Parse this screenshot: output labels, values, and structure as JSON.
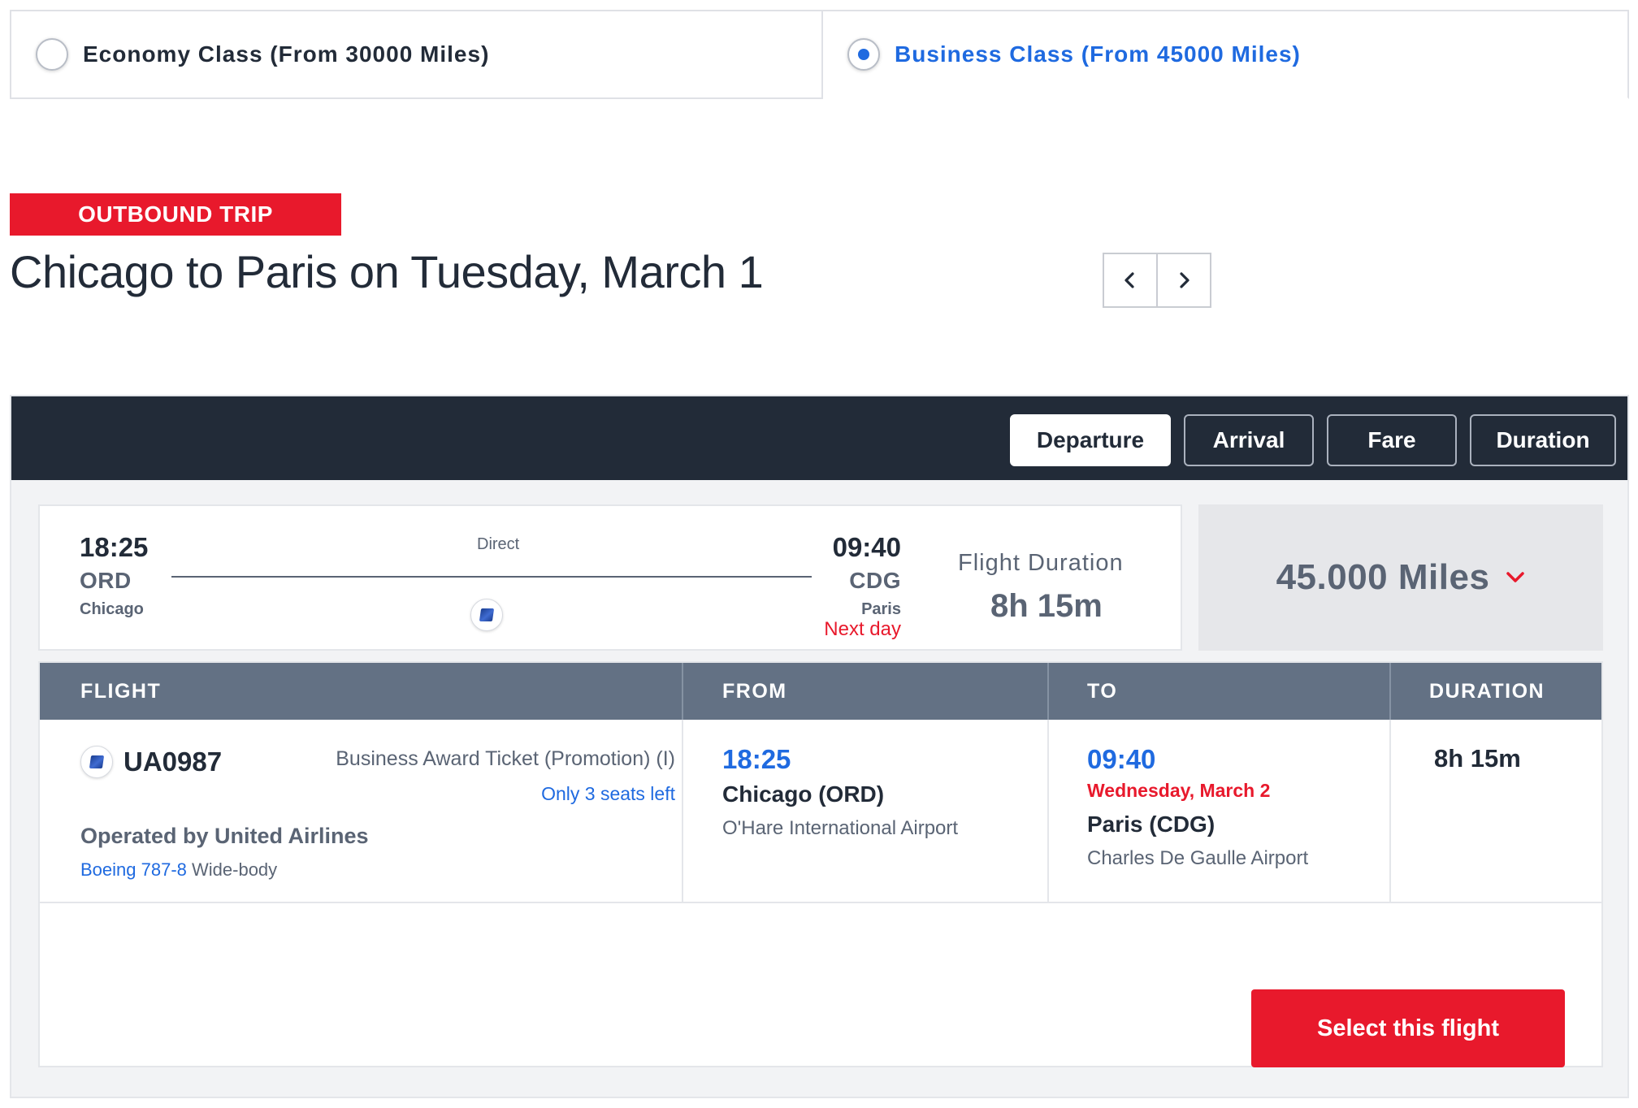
{
  "cabin_options": [
    {
      "label": "Economy Class (From 30000 Miles)",
      "selected": false
    },
    {
      "label": "Business Class (From 45000 Miles)",
      "selected": true
    }
  ],
  "trip": {
    "badge": "OUTBOUND TRIP",
    "title": "Chicago to Paris on Tuesday, March 1"
  },
  "date_nav": {
    "prev_icon": "chevron-left-icon",
    "next_icon": "chevron-right-icon"
  },
  "sort": {
    "options": [
      "Departure",
      "Arrival",
      "Fare",
      "Duration"
    ],
    "active": "Departure"
  },
  "summary": {
    "departure_time": "18:25",
    "departure_code": "ORD",
    "departure_city": "Chicago",
    "stops": "Direct",
    "arrival_time": "09:40",
    "arrival_code": "CDG",
    "arrival_city": "Paris",
    "next_day": "Next day",
    "duration_label": "Flight Duration",
    "duration": "8h 15m",
    "airline_icon": "united-airlines-logo-icon"
  },
  "fare": {
    "miles": "45.000 Miles",
    "toggle_icon": "chevron-down-icon"
  },
  "detail": {
    "headers": {
      "flight": "FLIGHT",
      "from": "FROM",
      "to": "TO",
      "duration": "DURATION"
    },
    "flight_number": "UA0987",
    "fare_name": "Business Award Ticket (Promotion) (I)",
    "seats_left": "Only 3 seats left",
    "operated_by": "Operated by United Airlines",
    "aircraft_type": "Boeing 787-8",
    "aircraft_body": "Wide-body",
    "from": {
      "time": "18:25",
      "city": "Chicago (ORD)",
      "airport": "O'Hare International Airport"
    },
    "to": {
      "time": "09:40",
      "date": "Wednesday, March 2",
      "city": "Paris (CDG)",
      "airport": "Charles De Gaulle Airport"
    },
    "duration": "8h 15m"
  },
  "select_button": "Select this flight",
  "colors": {
    "accent_red": "#e8192c",
    "link_blue": "#1f6ae0",
    "dark_navy": "#222b38",
    "slate_header": "#637184"
  }
}
